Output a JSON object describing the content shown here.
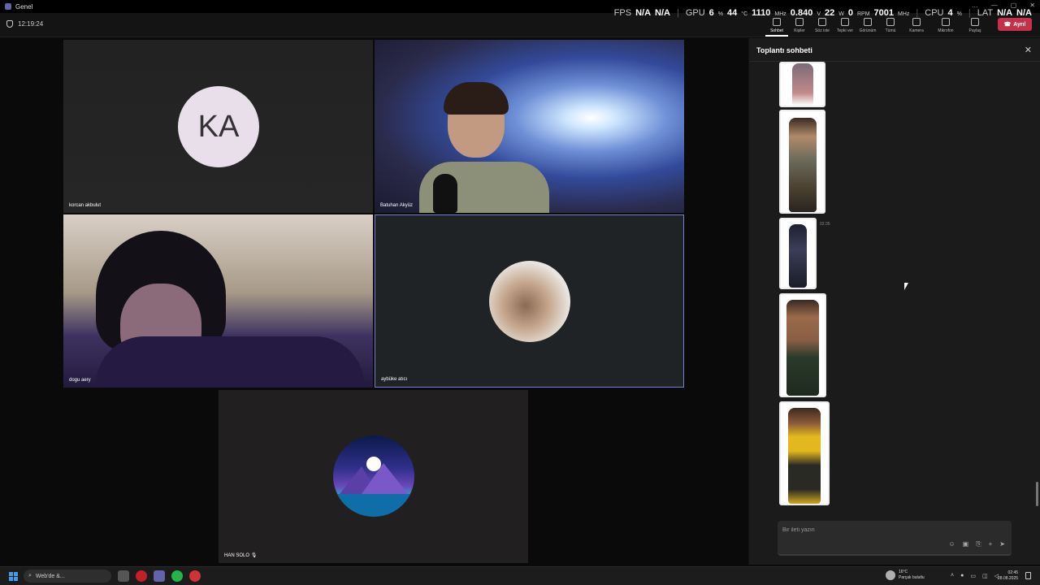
{
  "window": {
    "title": "Genel",
    "controls": [
      "…",
      "—",
      "▢",
      "✕"
    ]
  },
  "overlay": {
    "fps_label": "FPS",
    "fps_value": "N/A",
    "fps_value2": "N/A",
    "gpu_label": "GPU",
    "gpu_util": "6",
    "gpu_util_unit": "%",
    "gpu_temp": "44",
    "gpu_temp_unit": "°C",
    "gpu_clock": "1110",
    "gpu_clock_unit": "MHz",
    "gpu_volt": "0.840",
    "gpu_volt_unit": "V",
    "gpu_power": "22",
    "gpu_power_unit": "W",
    "fan": "0",
    "fan_unit": "RPM",
    "mem_clock": "7001",
    "mem_clock_unit": "MHz",
    "cpu_label": "CPU",
    "cpu_util": "4",
    "cpu_util_unit": "%",
    "lat_label": "LAT",
    "lat_value": "N/A",
    "lat_value2": "N/A"
  },
  "meeting": {
    "timer": "12:19:24",
    "toolbar": [
      {
        "key": "chat",
        "label": "Sohbet",
        "active": true
      },
      {
        "key": "people",
        "label": "Kişiler",
        "active": false
      },
      {
        "key": "raise",
        "label": "Söz iste",
        "active": false
      },
      {
        "key": "react",
        "label": "Tepki ver",
        "active": false
      },
      {
        "key": "view",
        "label": "Görünüm",
        "active": false
      },
      {
        "key": "more",
        "label": "Tümü",
        "active": false
      },
      {
        "key": "camera",
        "label": "Kamera",
        "active": false
      },
      {
        "key": "mic",
        "label": "Mikrofon",
        "active": false
      },
      {
        "key": "share",
        "label": "Paylaş",
        "active": false
      }
    ],
    "leave_label": "Ayrıl"
  },
  "participants": [
    {
      "name": "korcan akbulut",
      "initials": "KA"
    },
    {
      "name": "Batuhan Akyüz"
    },
    {
      "name": "dogu aery"
    },
    {
      "name": "aybüke atıcı"
    },
    {
      "name": "HAN SOLO"
    }
  ],
  "chat": {
    "title": "Toplantı sohbeti",
    "message_time": "02:35",
    "compose_placeholder": "Bir ileti yazın",
    "tools": [
      "☺",
      "▣",
      "⎘",
      "+",
      "➤"
    ]
  },
  "taskbar": {
    "search_text": "Web'de &...",
    "weather_temp": "16°C",
    "weather_desc": "Parçalı bulutlu",
    "time": "02:45",
    "date": "28.08.2025"
  },
  "colors": {
    "leave": "#c4314b",
    "accent": "#6264a7",
    "active_border": "#7a7fd6"
  }
}
